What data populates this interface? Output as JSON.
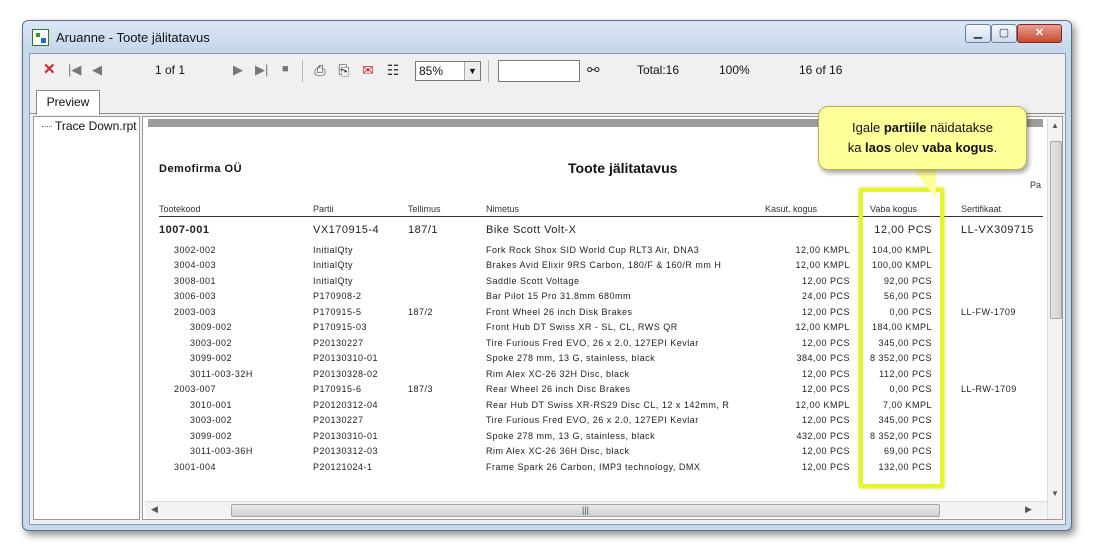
{
  "window": {
    "title": "Aruanne - Toote jälitatavus"
  },
  "toolbar": {
    "page_indicator": "1 of 1",
    "zoom": "85%",
    "search_value": "",
    "total": "Total:16",
    "percent": "100%",
    "count": "16 of 16"
  },
  "tabs": [
    {
      "label": "Preview"
    }
  ],
  "tree": {
    "item": "Trace Down.rpt"
  },
  "report": {
    "company": "Demofirma OÜ",
    "title": "Toote jälitatavus",
    "pa_cut": "Pa",
    "columns": {
      "tootekood": "Tootekood",
      "partii": "Partii",
      "tellimus": "Tellimus",
      "nimetus": "Nimetus",
      "kasut": "Kasut. kogus",
      "vaba": "Vaba kogus",
      "sertifikaat": "Sertifikaat"
    },
    "rows": [
      {
        "code": "1007-001",
        "partii": "VX170915-4",
        "tellimus": "187/1",
        "nimetus": "Bike Scott Volt-X",
        "kasut": "",
        "vaba": "12,00 PCS",
        "sert": "LL-VX309715",
        "indent": 0
      },
      {
        "code": "3002-002",
        "partii": "InitialQty",
        "tellimus": "",
        "nimetus": "Fork Rock Shox SID World Cup RLT3 Air, DNA3",
        "kasut": "12,00 KMPL",
        "vaba": "104,00 KMPL",
        "sert": "",
        "indent": 1
      },
      {
        "code": "3004-003",
        "partii": "InitialQty",
        "tellimus": "",
        "nimetus": "Brakes Avid Elixir 9RS Carbon, 180/F & 160/R mm H",
        "kasut": "12,00 KMPL",
        "vaba": "100,00 KMPL",
        "sert": "",
        "indent": 1
      },
      {
        "code": "3008-001",
        "partii": "InitialQty",
        "tellimus": "",
        "nimetus": "Saddle Scott Voltage",
        "kasut": "12,00 PCS",
        "vaba": "92,00 PCS",
        "sert": "",
        "indent": 1
      },
      {
        "code": "3006-003",
        "partii": "P170908-2",
        "tellimus": "",
        "nimetus": "Bar Pilot 15 Pro 31.8mm 680mm",
        "kasut": "24,00 PCS",
        "vaba": "56,00 PCS",
        "sert": "",
        "indent": 1
      },
      {
        "code": "2003-003",
        "partii": "P170915-5",
        "tellimus": "187/2",
        "nimetus": "Front Wheel 26 inch Disk Brakes",
        "kasut": "12,00 PCS",
        "vaba": "0,00 PCS",
        "sert": "LL-FW-1709",
        "indent": 1
      },
      {
        "code": "3009-002",
        "partii": "P170915-03",
        "tellimus": "",
        "nimetus": "Front Hub DT Swiss XR - SL, CL, RWS QR",
        "kasut": "12,00 KMPL",
        "vaba": "184,00 KMPL",
        "sert": "",
        "indent": 2
      },
      {
        "code": "3003-002",
        "partii": "P20130227",
        "tellimus": "",
        "nimetus": "Tire Furious Fred EVO, 26 x 2.0, 127EPI Kevlar",
        "kasut": "12,00 PCS",
        "vaba": "345,00 PCS",
        "sert": "",
        "indent": 2
      },
      {
        "code": "3099-002",
        "partii": "P20130310-01",
        "tellimus": "",
        "nimetus": "Spoke 278 mm, 13 G, stainless, black",
        "kasut": "384,00 PCS",
        "vaba": "8 352,00 PCS",
        "sert": "",
        "indent": 2
      },
      {
        "code": "3011-003-32H",
        "partii": "P20130328-02",
        "tellimus": "",
        "nimetus": "Rim Alex XC-26 32H Disc, black",
        "kasut": "12,00 PCS",
        "vaba": "112,00 PCS",
        "sert": "",
        "indent": 2
      },
      {
        "code": "2003-007",
        "partii": "P170915-6",
        "tellimus": "187/3",
        "nimetus": "Rear Wheel 26 inch Disc Brakes",
        "kasut": "12,00 PCS",
        "vaba": "0,00 PCS",
        "sert": "LL-RW-1709",
        "indent": 1
      },
      {
        "code": "3010-001",
        "partii": "P20120312-04",
        "tellimus": "",
        "nimetus": "Rear Hub DT Swiss XR-RS29 Disc CL, 12 x 142mm, R",
        "kasut": "12,00 KMPL",
        "vaba": "7,00 KMPL",
        "sert": "",
        "indent": 2
      },
      {
        "code": "3003-002",
        "partii": "P20130227",
        "tellimus": "",
        "nimetus": "Tire Furious Fred EVO, 26 x 2.0, 127EPI Kevlar",
        "kasut": "12,00 PCS",
        "vaba": "345,00 PCS",
        "sert": "",
        "indent": 2
      },
      {
        "code": "3099-002",
        "partii": "P20130310-01",
        "tellimus": "",
        "nimetus": "Spoke 278 mm, 13 G, stainless, black",
        "kasut": "432,00 PCS",
        "vaba": "8 352,00 PCS",
        "sert": "",
        "indent": 2
      },
      {
        "code": "3011-003-36H",
        "partii": "P20130312-03",
        "tellimus": "",
        "nimetus": "Rim Alex XC-26 36H Disc, black",
        "kasut": "12,00 PCS",
        "vaba": "69,00 PCS",
        "sert": "",
        "indent": 2
      },
      {
        "code": "3001-004",
        "partii": "P20121024-1",
        "tellimus": "",
        "nimetus": "Frame Spark 26 Carbon, IMP3 technology, DMX",
        "kasut": "12,00 PCS",
        "vaba": "132,00 PCS",
        "sert": "",
        "indent": 1
      }
    ]
  },
  "callout": {
    "p1": "Igale ",
    "b1": "partiile",
    "p2": " näidatakse",
    "p3": "ka ",
    "b2": "laos",
    "p4": " olev ",
    "b3": "vaba kogus",
    "p5": "."
  },
  "colors": {
    "highlight": "#e6f52a",
    "callout_bg": "#ffff9a",
    "close_button": "#c74a32"
  },
  "icons": [
    "close-report-icon",
    "first-page-icon",
    "prev-page-icon",
    "next-page-icon",
    "last-page-icon",
    "stop-icon",
    "print-icon",
    "print-setup-icon",
    "export-icon",
    "group-tree-icon",
    "search-binoculars-icon"
  ]
}
